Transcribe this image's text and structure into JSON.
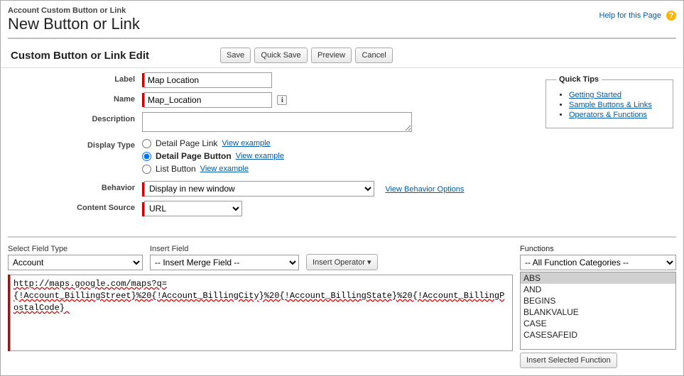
{
  "header": {
    "breadcrumb": "Account Custom Button or Link",
    "title": "New Button or Link",
    "help_text": "Help for this Page",
    "help_glyph": "?"
  },
  "section": {
    "title": "Custom Button or Link Edit",
    "buttons": {
      "save": "Save",
      "quick_save": "Quick Save",
      "preview": "Preview",
      "cancel": "Cancel"
    }
  },
  "form": {
    "label_field": {
      "label": "Label",
      "value": "Map Location"
    },
    "name_field": {
      "label": "Name",
      "value": "Map_Location"
    },
    "desc_field": {
      "label": "Description",
      "value": ""
    },
    "display_type": {
      "label": "Display Type",
      "options": [
        {
          "label": "Detail Page Link",
          "example": "View example",
          "selected": false
        },
        {
          "label": "Detail Page Button",
          "example": "View example",
          "selected": true
        },
        {
          "label": "List Button",
          "example": "View example",
          "selected": false
        }
      ]
    },
    "behavior": {
      "label": "Behavior",
      "value": "Display in new window",
      "link": "View Behavior Options"
    },
    "content_source": {
      "label": "Content Source",
      "value": "URL"
    }
  },
  "quick_tips": {
    "title": "Quick Tips",
    "links": [
      "Getting Started",
      "Sample Buttons & Links",
      "Operators & Functions"
    ]
  },
  "lower": {
    "field_type": {
      "label": "Select Field Type",
      "value": "Account"
    },
    "insert_field": {
      "label": "Insert Field",
      "value": "-- Insert Merge Field --"
    },
    "insert_operator": "Insert Operator",
    "url_value": "http://maps.google.com/maps?q={!Account_BillingStreet}%20{!Account_BillingCity}%20{!Account_BillingState}%20{!Account_BillingPostalCode} ",
    "functions": {
      "label": "Functions",
      "category_value": "-- All Function Categories --",
      "list": [
        "ABS",
        "AND",
        "BEGINS",
        "BLANKVALUE",
        "CASE",
        "CASESAFEID"
      ],
      "insert_btn": "Insert Selected Function"
    }
  }
}
